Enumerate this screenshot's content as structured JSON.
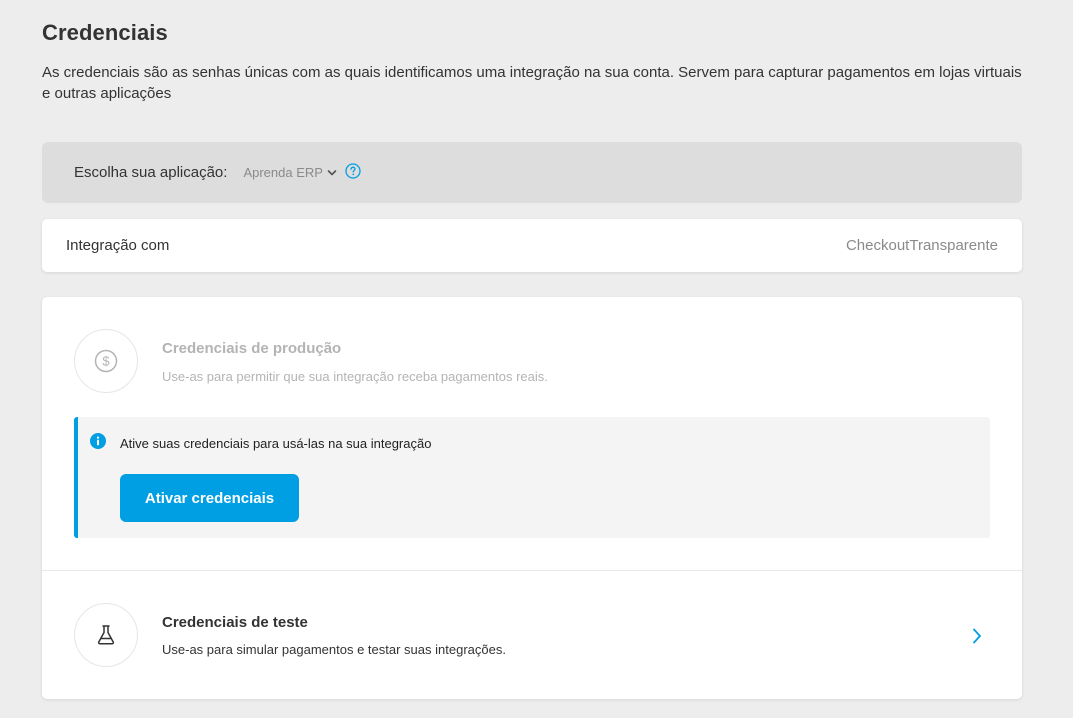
{
  "header": {
    "title": "Credenciais",
    "subtitle": "As credenciais são as senhas únicas com as quais identificamos uma integração na sua conta. Servem para capturar pagamentos em lojas virtuais e outras aplicações"
  },
  "app_selector": {
    "label": "Escolha sua aplicação:",
    "selected": "Aprenda ERP",
    "icons": [
      "chevron-down-icon",
      "help-icon"
    ]
  },
  "integration": {
    "label": "Integração com",
    "value": "CheckoutTransparente"
  },
  "production": {
    "title": "Credenciais de produção",
    "description": "Use-as para permitir que sua integração receba pagamentos reais.",
    "icon": "dollar-coin-icon",
    "notice": {
      "message": "Ative suas credenciais para usá-las na sua integração",
      "button_label": "Ativar credenciais",
      "icon": "info-icon"
    }
  },
  "test": {
    "title": "Credenciais de teste",
    "description": "Use-as para simular pagamentos e testar suas integrações.",
    "icon": "flask-icon"
  },
  "colors": {
    "accent": "#009ee3",
    "background": "#ededed",
    "card": "#ffffff",
    "muted_text": "#b4b4b4"
  }
}
